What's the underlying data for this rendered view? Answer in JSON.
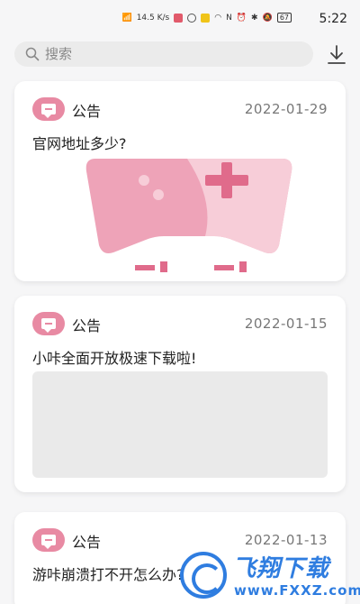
{
  "statusbar": {
    "net_speed": "14.5 K/s",
    "battery": "67",
    "time": "5:22"
  },
  "search": {
    "placeholder": "搜索"
  },
  "cards": [
    {
      "type": "公告",
      "date": "2022-01-29",
      "title": "官网地址多少?"
    },
    {
      "type": "公告",
      "date": "2022-01-15",
      "title": "小咔全面开放极速下载啦!"
    },
    {
      "type": "公告",
      "date": "2022-01-13",
      "title": "游咔崩溃打不开怎么办?"
    }
  ],
  "watermark": {
    "title": "飞翔下载",
    "url": "www.FXXZ.com"
  },
  "colors": {
    "accent": "#e88aa3",
    "background": "#f6f6f7",
    "watermark": "#2f7de0"
  }
}
